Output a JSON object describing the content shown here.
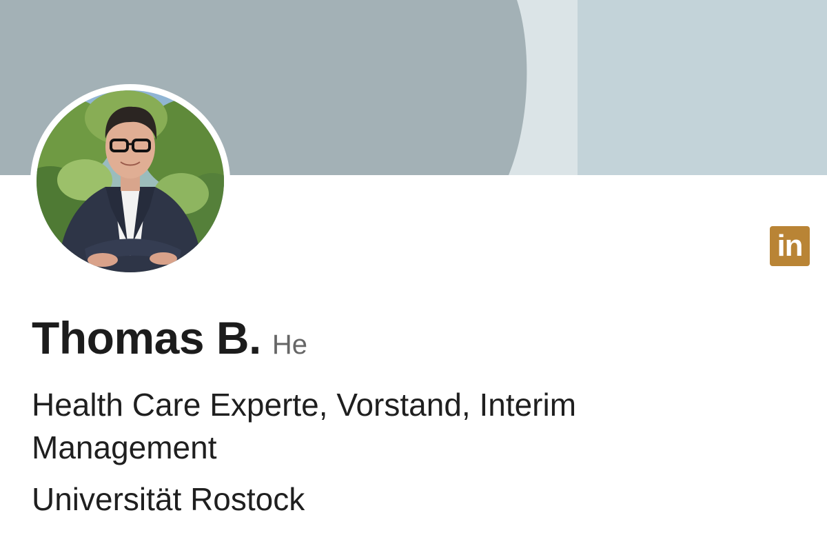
{
  "profile": {
    "name": "Thomas B.",
    "pronoun": "He",
    "headline": "Health Care Experte, Vorstand, Interim Management",
    "education": "Universität Rostock",
    "linkedin_badge_label": "in"
  },
  "colors": {
    "banner_dark": "#a3b1b6",
    "banner_light": "#dbe4e7",
    "banner_right": "#c3d3d9",
    "linkedin_badge": "#b98435",
    "name_text": "#1c1c1c",
    "pronoun_text": "#666666"
  },
  "icons": {
    "linkedin": "linkedin-icon",
    "avatar": "profile-photo"
  }
}
